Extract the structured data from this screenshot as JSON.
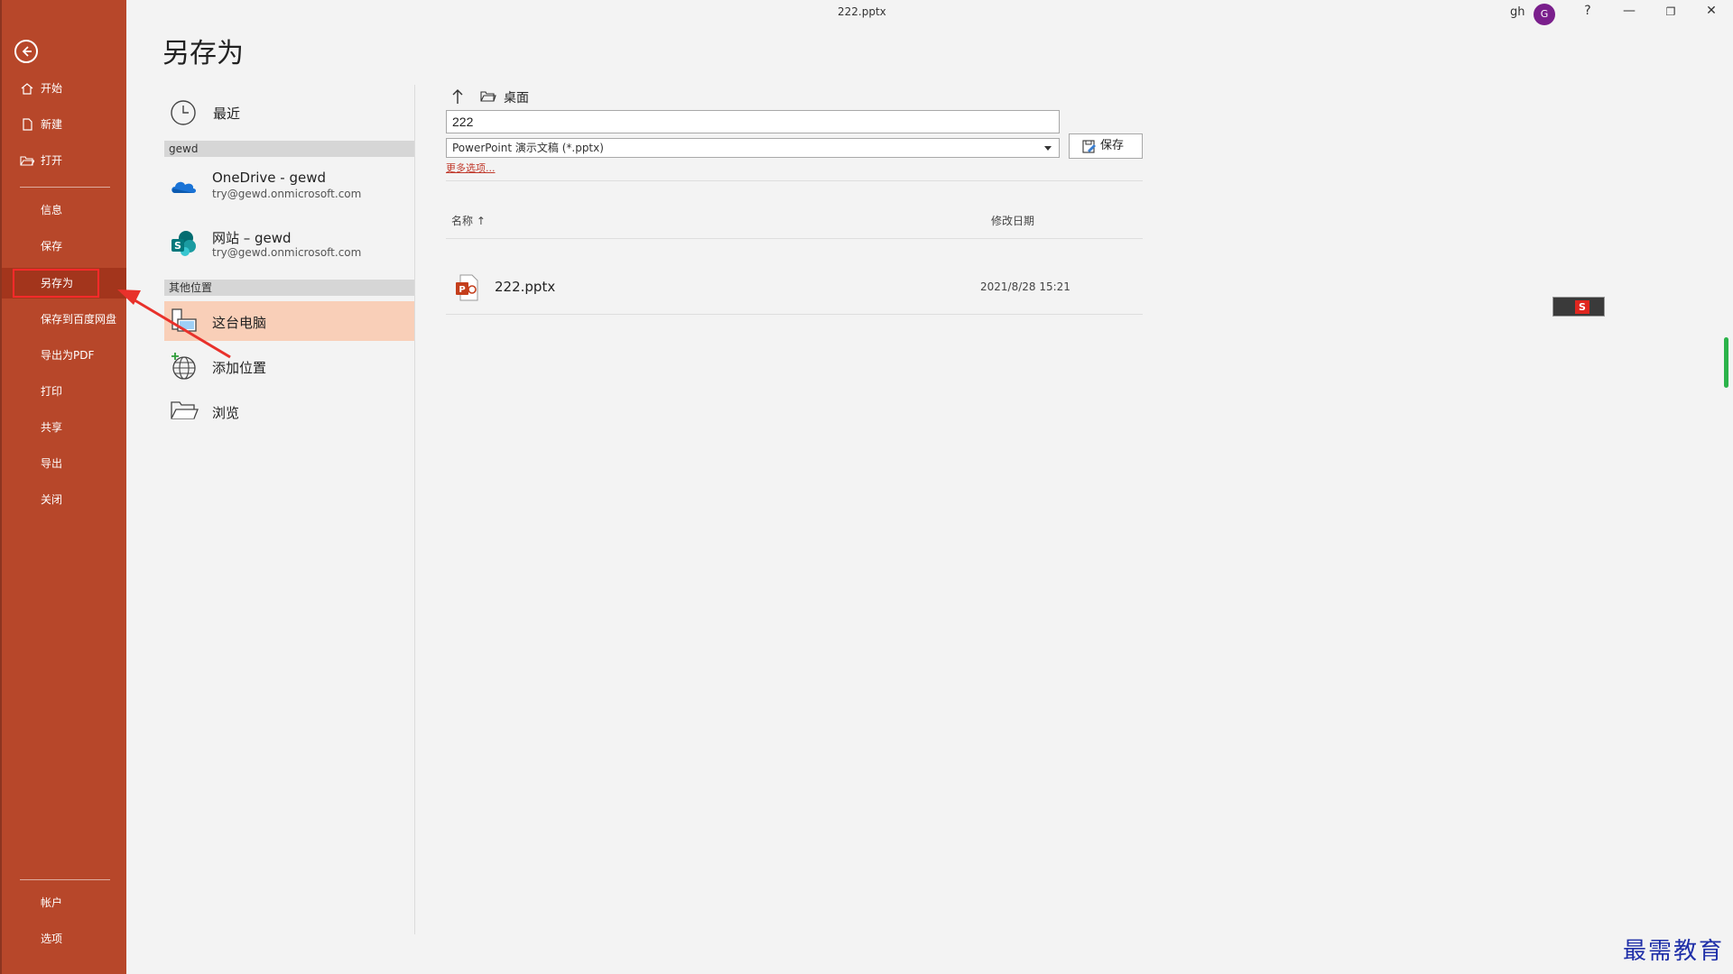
{
  "window": {
    "document_title": "222.pptx",
    "user_name": "gh",
    "avatar_initial": "G",
    "help_label": "?",
    "minimize_label": "—",
    "restore_label": "❐",
    "close_label": "✕"
  },
  "nav": {
    "top_items": [
      {
        "label": "开始",
        "icon": "home-icon"
      },
      {
        "label": "新建",
        "icon": "new-file-icon"
      },
      {
        "label": "打开",
        "icon": "folder-open-icon"
      }
    ],
    "middle_items": [
      {
        "label": "信息"
      },
      {
        "label": "保存"
      },
      {
        "label": "另存为",
        "selected": true
      },
      {
        "label": "保存到百度网盘"
      },
      {
        "label": "导出为PDF"
      },
      {
        "label": "打印"
      },
      {
        "label": "共享"
      },
      {
        "label": "导出"
      },
      {
        "label": "关闭"
      }
    ],
    "bottom_items": [
      {
        "label": "帐户"
      },
      {
        "label": "选项"
      }
    ]
  },
  "page": {
    "heading": "另存为"
  },
  "locations": {
    "recent_label": "最近",
    "group_gewd": "gewd",
    "onedrive_title": "OneDrive - gewd",
    "onedrive_sub": "try@gewd.onmicrosoft.com",
    "site_title": "网站 – gewd",
    "site_sub": "try@gewd.onmicrosoft.com",
    "group_other": "其他位置",
    "this_pc_label": "这台电脑",
    "add_place_label": "添加位置",
    "browse_label": "浏览"
  },
  "filepane": {
    "current_folder": "桌面",
    "file_name_value": "222",
    "file_type_value": "PowerPoint 演示文稿 (*.pptx)",
    "save_button_label": "保存",
    "more_options_link": "更多选项...",
    "col_name_header": "名称 ↑",
    "col_date_header": "修改日期",
    "files": [
      {
        "name": "222.pptx",
        "modified": "2021/8/28 15:21"
      }
    ]
  },
  "overlay": {
    "watermark": "最需教育"
  },
  "colors": {
    "nav_bg": "#b7472a",
    "selected_location_bg": "#f9cfb8",
    "highlight_box": "#ff2a2a",
    "annotation_arrow": "#e8312b",
    "link": "#c0392b"
  }
}
